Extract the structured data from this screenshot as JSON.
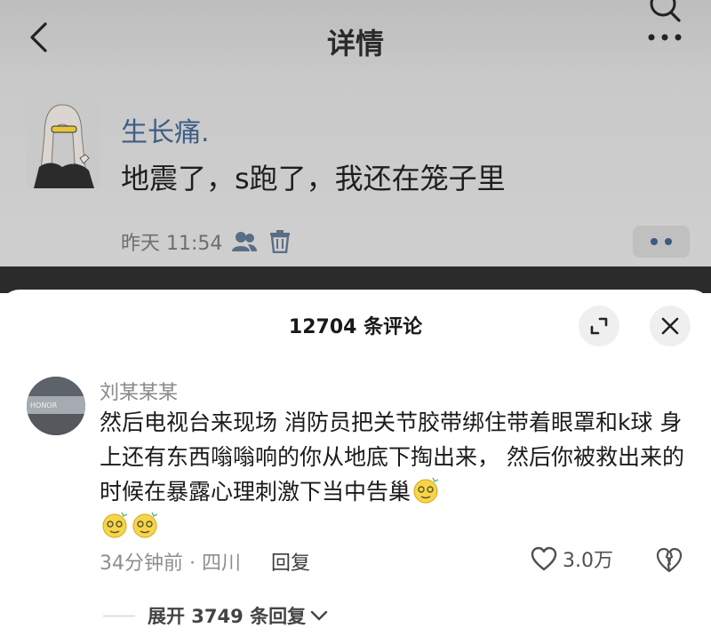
{
  "detail": {
    "title": "详情",
    "icons": {
      "back": "chevron-left-icon",
      "search": "search-icon",
      "more": "more-dots-icon"
    },
    "post": {
      "username": "生长痛.",
      "text": "地震了，s跑了，我还在笼子里",
      "time": "昨天 11:54",
      "icons": [
        "person-visibility-icon",
        "trash-icon"
      ],
      "username_color": "#3d5e86"
    }
  },
  "comments_sheet": {
    "title": "12704 条评论",
    "icons": {
      "expand": "expand-icon",
      "close": "close-icon"
    },
    "comment": {
      "username": "刘某某某",
      "text": "然后电视台来现场 消防员把关节胶带绑住带着眼罩和k球 身上还有东西嗡嗡响的你从地底下掏出来， 然后你被救出来的时候在暴露心理刺激下当中告巢",
      "emoji": "dizzy-face-emoji",
      "emoji_count": 3,
      "time_location": "34分钟前 · 四川",
      "reply_label": "回复",
      "likes": "3.0万",
      "like_icon": "heart-icon",
      "dislike_icon": "broken-heart-icon"
    },
    "expand_replies": "展开 3749 条回复"
  }
}
